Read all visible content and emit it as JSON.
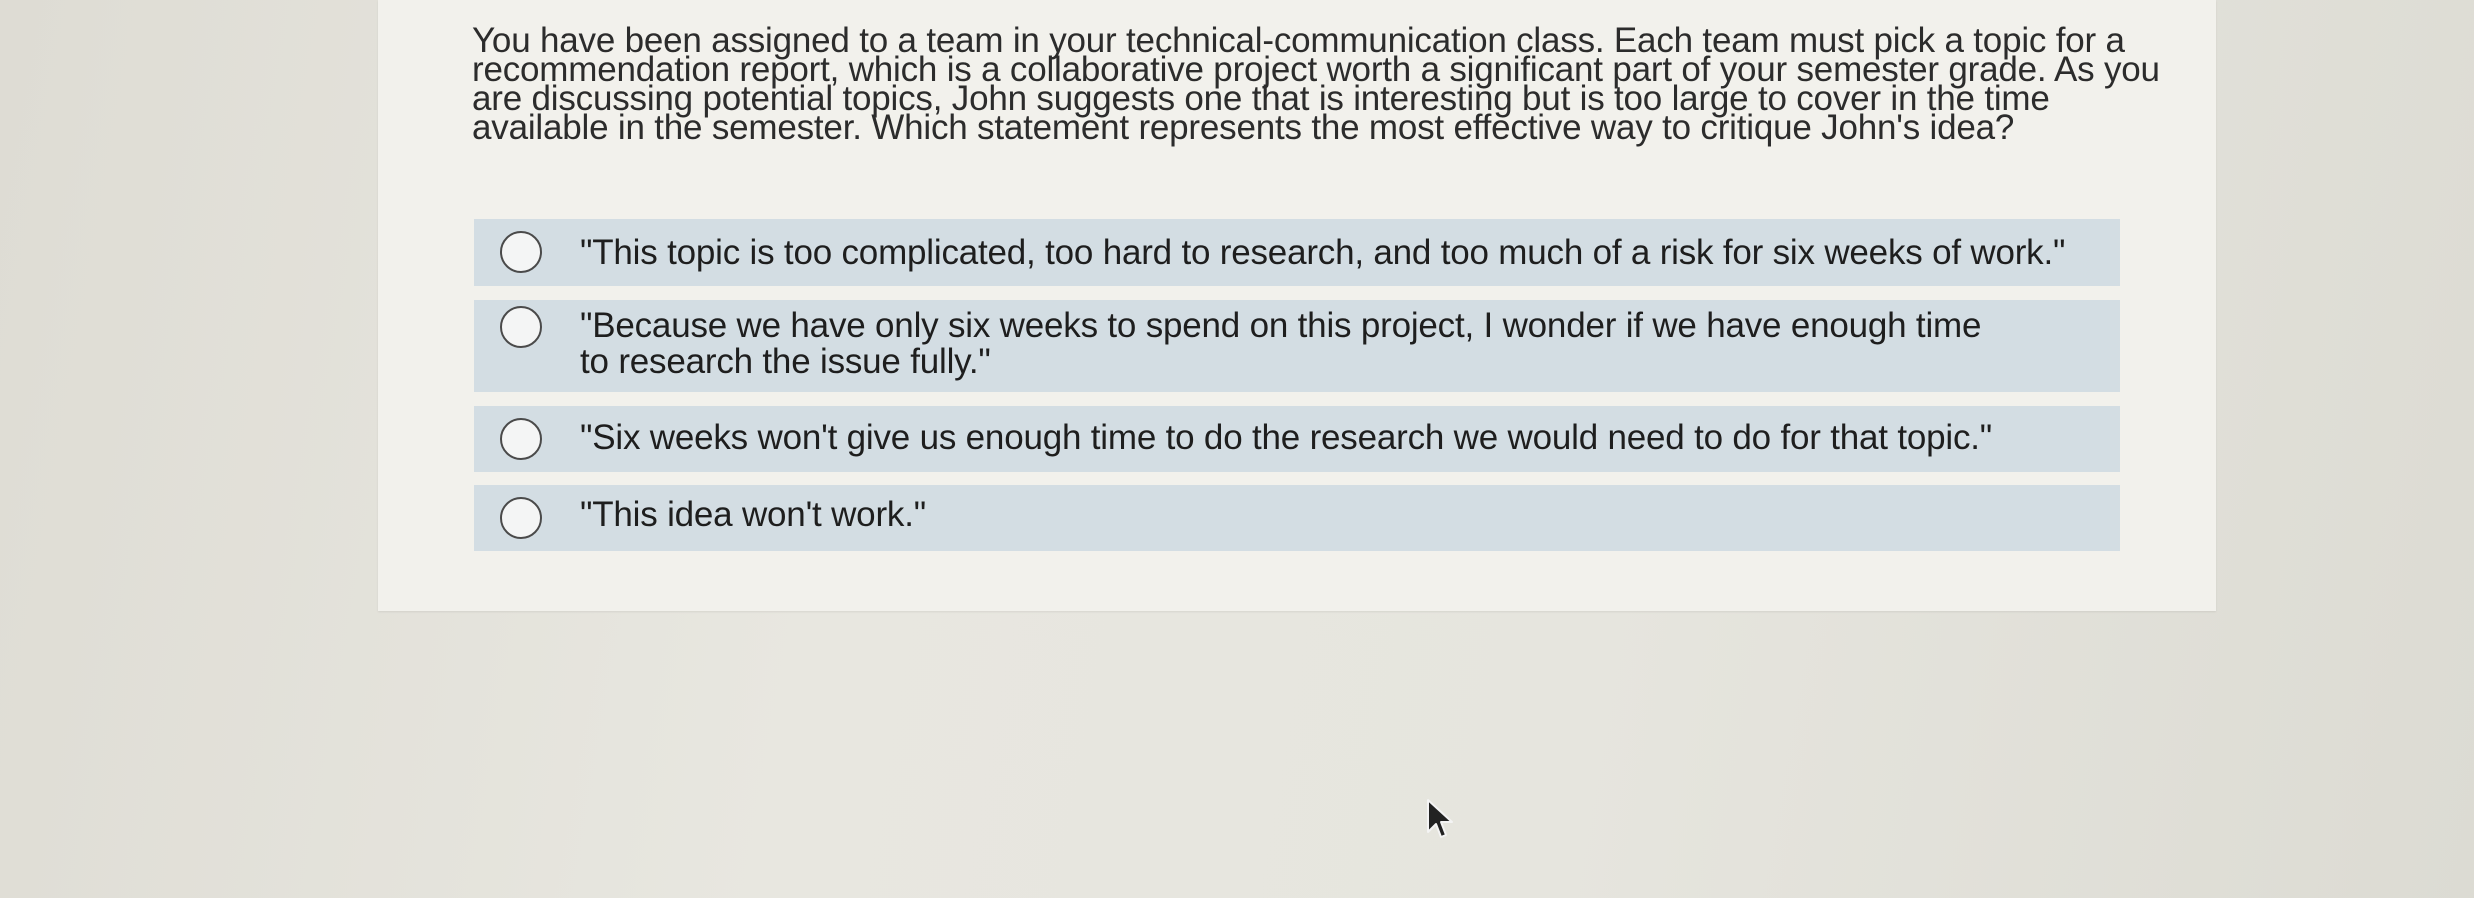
{
  "question": {
    "text": "You have been assigned to a team in your technical-communication class. Each team must pick a topic for a recommendation report, which is a collaborative project worth a significant part of your semester grade. As you are discussing potential topics, John suggests one that is interesting but is too large to cover in the time available in the semester. Which statement represents the most effective way to critique John's idea?"
  },
  "options": [
    {
      "label": "\"This topic is too complicated, too hard to research, and too much of a risk for six weeks of work.\""
    },
    {
      "label": "\"Because we have only six weeks to spend on this project, I wonder if we have enough time to research the issue fully.\""
    },
    {
      "label": "\"Six weeks won't give us enough time to do the research we would need to do for that topic.\""
    },
    {
      "label": "\"This idea won't work.\""
    }
  ]
}
